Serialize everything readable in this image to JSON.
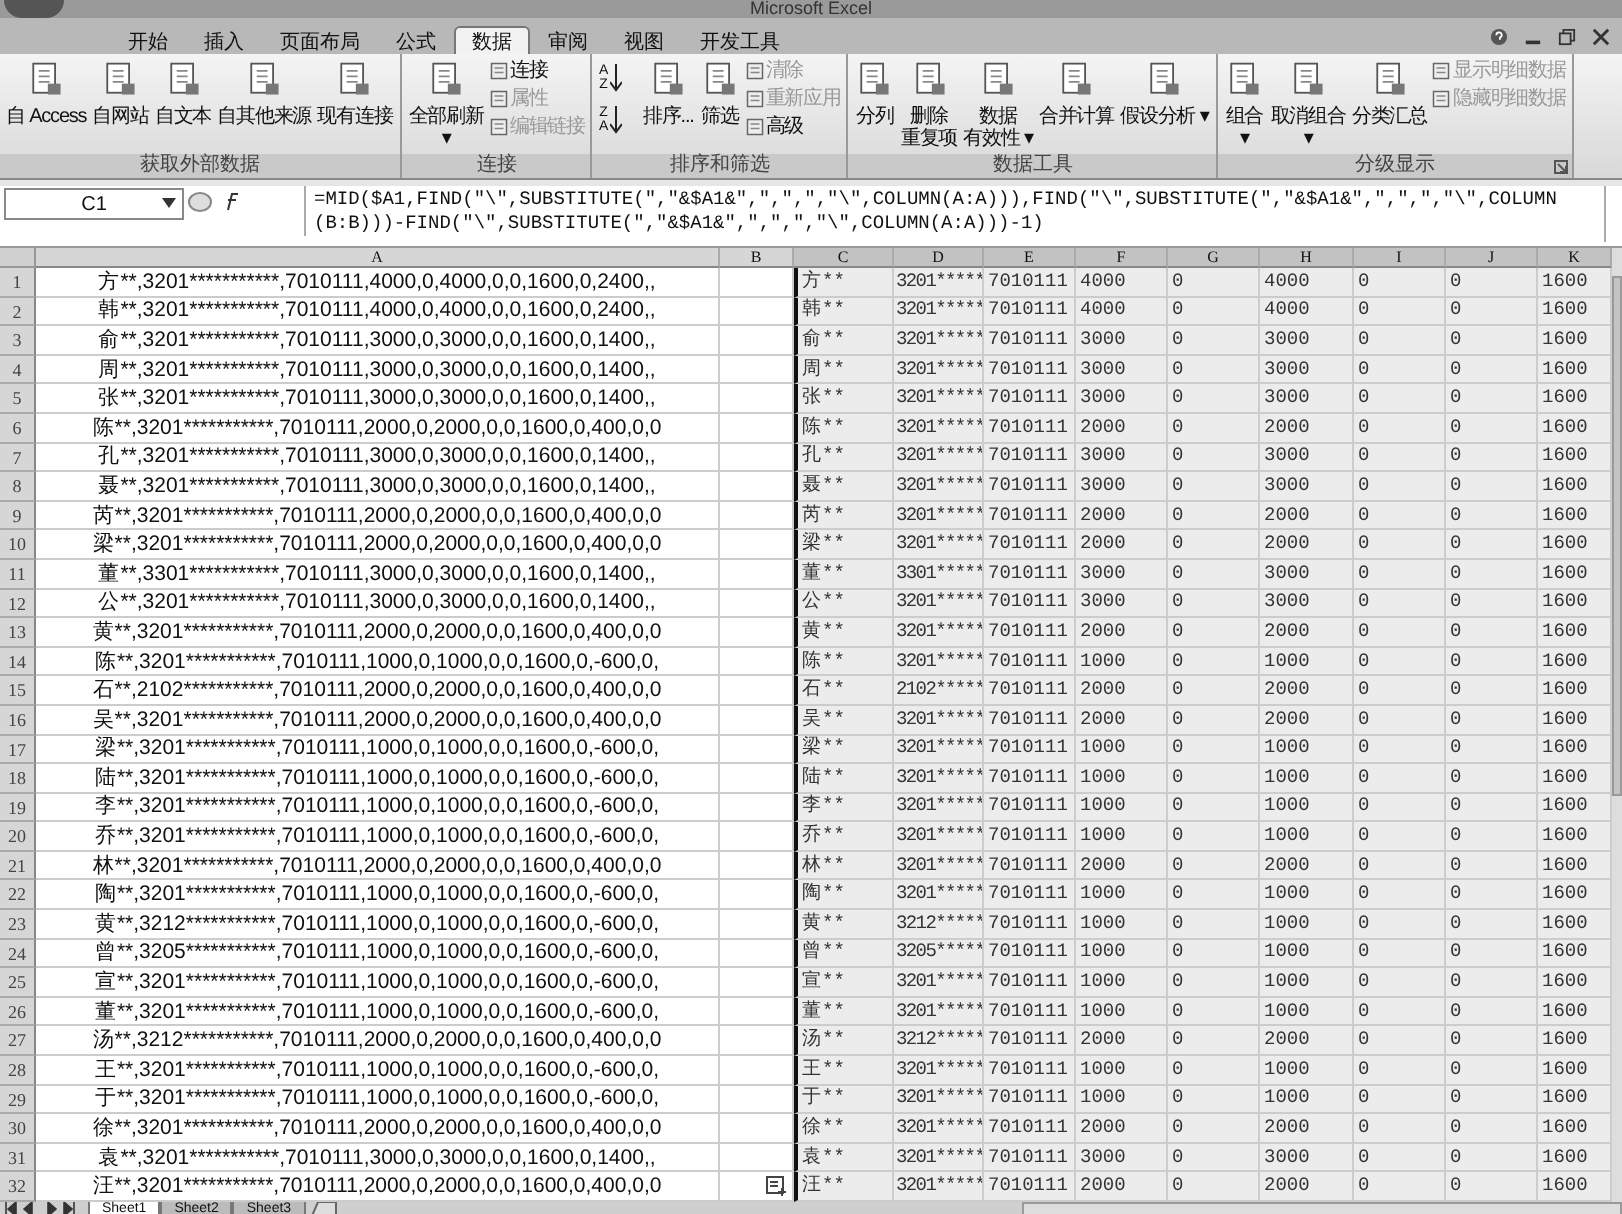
{
  "window": {
    "title": "Microsoft Excel"
  },
  "tabs": [
    {
      "label": "开始",
      "selected": false
    },
    {
      "label": "插入",
      "selected": false
    },
    {
      "label": "页面布局",
      "selected": false
    },
    {
      "label": "公式",
      "selected": false
    },
    {
      "label": "数据",
      "selected": true
    },
    {
      "label": "审阅",
      "selected": false
    },
    {
      "label": "视图",
      "selected": false
    },
    {
      "label": "开发工具",
      "selected": false
    }
  ],
  "ribbon_groups": [
    {
      "label": "获取外部数据",
      "launcher": false,
      "buttons": [
        {
          "kind": "large",
          "lines": [
            "自 Access"
          ]
        },
        {
          "kind": "large",
          "lines": [
            "自网站"
          ]
        },
        {
          "kind": "large",
          "lines": [
            "自文本"
          ]
        },
        {
          "kind": "large",
          "lines": [
            "自其他来源"
          ]
        },
        {
          "kind": "large",
          "lines": [
            "现有连接"
          ]
        }
      ]
    },
    {
      "label": "连接",
      "launcher": false,
      "buttons": [
        {
          "kind": "large",
          "lines": [
            "全部刷新",
            "▾"
          ]
        },
        {
          "kind": "small",
          "label": "连接",
          "disabled": false
        },
        {
          "kind": "small",
          "label": "属性",
          "disabled": true
        },
        {
          "kind": "small",
          "label": "编辑链接",
          "disabled": true
        }
      ]
    },
    {
      "label": "排序和筛选",
      "launcher": false,
      "buttons": [
        {
          "kind": "sort",
          "label": "A Z"
        },
        {
          "kind": "sort",
          "label": "Z A"
        },
        {
          "kind": "large",
          "lines": [
            "排序..."
          ]
        },
        {
          "kind": "large",
          "lines": [
            "筛选"
          ]
        },
        {
          "kind": "small",
          "label": "清除",
          "disabled": true
        },
        {
          "kind": "small",
          "label": "重新应用",
          "disabled": true
        },
        {
          "kind": "small",
          "label": "高级",
          "disabled": false
        }
      ]
    },
    {
      "label": "数据工具",
      "launcher": false,
      "buttons": [
        {
          "kind": "large",
          "lines": [
            "分列"
          ]
        },
        {
          "kind": "large",
          "lines": [
            "删除",
            "重复项"
          ]
        },
        {
          "kind": "large",
          "lines": [
            "数据",
            "有效性 ▾"
          ]
        },
        {
          "kind": "large",
          "lines": [
            "合并计算"
          ]
        },
        {
          "kind": "large",
          "lines": [
            "假设分析 ▾"
          ]
        }
      ]
    },
    {
      "label": "分级显示",
      "launcher": true,
      "buttons": [
        {
          "kind": "large",
          "lines": [
            "组合",
            "▾"
          ]
        },
        {
          "kind": "large",
          "lines": [
            "取消组合",
            "▾"
          ]
        },
        {
          "kind": "large",
          "lines": [
            "分类汇总"
          ]
        },
        {
          "kind": "small",
          "label": "显示明细数据",
          "disabled": true
        },
        {
          "kind": "small",
          "label": "隐藏明细数据",
          "disabled": true
        }
      ]
    }
  ],
  "formula_bar": {
    "name_box": "C1",
    "formula": "=MID($A1,FIND(\"\\\",SUBSTITUTE(\",\"&$A1&\",\",\",\",\"\\\",COLUMN(A:A))),FIND(\"\\\",SUBSTITUTE(\",\"&$A1&\",\",\",\",\"\\\",COLUMN(B:B)))-FIND(\"\\\",SUBSTITUTE(\",\"&$A1&\",\",\",\",\"\\\",COLUMN(A:A)))-1)"
  },
  "sheet": {
    "columns": [
      "A",
      "B",
      "C",
      "D",
      "E",
      "F",
      "G",
      "H",
      "I",
      "J",
      "K"
    ],
    "rows": [
      {
        "number": "1",
        "a": "方**,3201***********,7010111,4000,0,4000,0,0,1600,0,2400,,",
        "values": [
          "方**",
          "3201*****",
          "7010111",
          "4000",
          "0",
          "4000",
          "0",
          "0",
          "1600"
        ]
      },
      {
        "number": "2",
        "a": "韩**,3201***********,7010111,4000,0,4000,0,0,1600,0,2400,,",
        "values": [
          "韩**",
          "3201*****",
          "7010111",
          "4000",
          "0",
          "4000",
          "0",
          "0",
          "1600"
        ]
      },
      {
        "number": "3",
        "a": "俞**,3201***********,7010111,3000,0,3000,0,0,1600,0,1400,,",
        "values": [
          "俞**",
          "3201*****",
          "7010111",
          "3000",
          "0",
          "3000",
          "0",
          "0",
          "1600"
        ]
      },
      {
        "number": "4",
        "a": "周**,3201***********,7010111,3000,0,3000,0,0,1600,0,1400,,",
        "values": [
          "周**",
          "3201*****",
          "7010111",
          "3000",
          "0",
          "3000",
          "0",
          "0",
          "1600"
        ]
      },
      {
        "number": "5",
        "a": "张**,3201***********,7010111,3000,0,3000,0,0,1600,0,1400,,",
        "values": [
          "张**",
          "3201*****",
          "7010111",
          "3000",
          "0",
          "3000",
          "0",
          "0",
          "1600"
        ]
      },
      {
        "number": "6",
        "a": "陈**,3201***********,7010111,2000,0,2000,0,0,1600,0,400,0,0",
        "values": [
          "陈**",
          "3201*****",
          "7010111",
          "2000",
          "0",
          "2000",
          "0",
          "0",
          "1600"
        ]
      },
      {
        "number": "7",
        "a": "孔**,3201***********,7010111,3000,0,3000,0,0,1600,0,1400,,",
        "values": [
          "孔**",
          "3201*****",
          "7010111",
          "3000",
          "0",
          "3000",
          "0",
          "0",
          "1600"
        ]
      },
      {
        "number": "8",
        "a": "聂**,3201***********,7010111,3000,0,3000,0,0,1600,0,1400,,",
        "values": [
          "聂**",
          "3201*****",
          "7010111",
          "3000",
          "0",
          "3000",
          "0",
          "0",
          "1600"
        ]
      },
      {
        "number": "9",
        "a": "芮**,3201***********,7010111,2000,0,2000,0,0,1600,0,400,0,0",
        "values": [
          "芮**",
          "3201*****",
          "7010111",
          "2000",
          "0",
          "2000",
          "0",
          "0",
          "1600"
        ]
      },
      {
        "number": "10",
        "a": "梁**,3201***********,7010111,2000,0,2000,0,0,1600,0,400,0,0",
        "values": [
          "梁**",
          "3201*****",
          "7010111",
          "2000",
          "0",
          "2000",
          "0",
          "0",
          "1600"
        ]
      },
      {
        "number": "11",
        "a": "董**,3301***********,7010111,3000,0,3000,0,0,1600,0,1400,,",
        "values": [
          "董**",
          "3301*****",
          "7010111",
          "3000",
          "0",
          "3000",
          "0",
          "0",
          "1600"
        ]
      },
      {
        "number": "12",
        "a": "公**,3201***********,7010111,3000,0,3000,0,0,1600,0,1400,,",
        "values": [
          "公**",
          "3201*****",
          "7010111",
          "3000",
          "0",
          "3000",
          "0",
          "0",
          "1600"
        ]
      },
      {
        "number": "13",
        "a": "黄**,3201***********,7010111,2000,0,2000,0,0,1600,0,400,0,0",
        "values": [
          "黄**",
          "3201*****",
          "7010111",
          "2000",
          "0",
          "2000",
          "0",
          "0",
          "1600"
        ]
      },
      {
        "number": "14",
        "a": "陈**,3201***********,7010111,1000,0,1000,0,0,1600,0,-600,0,",
        "values": [
          "陈**",
          "3201*****",
          "7010111",
          "1000",
          "0",
          "1000",
          "0",
          "0",
          "1600"
        ]
      },
      {
        "number": "15",
        "a": "石**,2102***********,7010111,2000,0,2000,0,0,1600,0,400,0,0",
        "values": [
          "石**",
          "2102*****",
          "7010111",
          "2000",
          "0",
          "2000",
          "0",
          "0",
          "1600"
        ]
      },
      {
        "number": "16",
        "a": "吴**,3201***********,7010111,2000,0,2000,0,0,1600,0,400,0,0",
        "values": [
          "吴**",
          "3201*****",
          "7010111",
          "2000",
          "0",
          "2000",
          "0",
          "0",
          "1600"
        ]
      },
      {
        "number": "17",
        "a": "梁**,3201***********,7010111,1000,0,1000,0,0,1600,0,-600,0,",
        "values": [
          "梁**",
          "3201*****",
          "7010111",
          "1000",
          "0",
          "1000",
          "0",
          "0",
          "1600"
        ]
      },
      {
        "number": "18",
        "a": "陆**,3201***********,7010111,1000,0,1000,0,0,1600,0,-600,0,",
        "values": [
          "陆**",
          "3201*****",
          "7010111",
          "1000",
          "0",
          "1000",
          "0",
          "0",
          "1600"
        ]
      },
      {
        "number": "19",
        "a": "李**,3201***********,7010111,1000,0,1000,0,0,1600,0,-600,0,",
        "values": [
          "李**",
          "3201*****",
          "7010111",
          "1000",
          "0",
          "1000",
          "0",
          "0",
          "1600"
        ]
      },
      {
        "number": "20",
        "a": "乔**,3201***********,7010111,1000,0,1000,0,0,1600,0,-600,0,",
        "values": [
          "乔**",
          "3201*****",
          "7010111",
          "1000",
          "0",
          "1000",
          "0",
          "0",
          "1600"
        ]
      },
      {
        "number": "21",
        "a": "林**,3201***********,7010111,2000,0,2000,0,0,1600,0,400,0,0",
        "values": [
          "林**",
          "3201*****",
          "7010111",
          "2000",
          "0",
          "2000",
          "0",
          "0",
          "1600"
        ]
      },
      {
        "number": "22",
        "a": "陶**,3201***********,7010111,1000,0,1000,0,0,1600,0,-600,0,",
        "values": [
          "陶**",
          "3201*****",
          "7010111",
          "1000",
          "0",
          "1000",
          "0",
          "0",
          "1600"
        ]
      },
      {
        "number": "23",
        "a": "黄**,3212***********,7010111,1000,0,1000,0,0,1600,0,-600,0,",
        "values": [
          "黄**",
          "3212*****",
          "7010111",
          "1000",
          "0",
          "1000",
          "0",
          "0",
          "1600"
        ]
      },
      {
        "number": "24",
        "a": "曾**,3205***********,7010111,1000,0,1000,0,0,1600,0,-600,0,",
        "values": [
          "曾**",
          "3205*****",
          "7010111",
          "1000",
          "0",
          "1000",
          "0",
          "0",
          "1600"
        ]
      },
      {
        "number": "25",
        "a": "宣**,3201***********,7010111,1000,0,1000,0,0,1600,0,-600,0,",
        "values": [
          "宣**",
          "3201*****",
          "7010111",
          "1000",
          "0",
          "1000",
          "0",
          "0",
          "1600"
        ]
      },
      {
        "number": "26",
        "a": "董**,3201***********,7010111,1000,0,1000,0,0,1600,0,-600,0,",
        "values": [
          "董**",
          "3201*****",
          "7010111",
          "1000",
          "0",
          "1000",
          "0",
          "0",
          "1600"
        ]
      },
      {
        "number": "27",
        "a": "汤**,3212***********,7010111,2000,0,2000,0,0,1600,0,400,0,0",
        "values": [
          "汤**",
          "3212*****",
          "7010111",
          "2000",
          "0",
          "2000",
          "0",
          "0",
          "1600"
        ]
      },
      {
        "number": "28",
        "a": "王**,3201***********,7010111,1000,0,1000,0,0,1600,0,-600,0,",
        "values": [
          "王**",
          "3201*****",
          "7010111",
          "1000",
          "0",
          "1000",
          "0",
          "0",
          "1600"
        ]
      },
      {
        "number": "29",
        "a": "于**,3201***********,7010111,1000,0,1000,0,0,1600,0,-600,0,",
        "values": [
          "于**",
          "3201*****",
          "7010111",
          "1000",
          "0",
          "1000",
          "0",
          "0",
          "1600"
        ]
      },
      {
        "number": "30",
        "a": "徐**,3201***********,7010111,2000,0,2000,0,0,1600,0,400,0,0",
        "values": [
          "徐**",
          "3201*****",
          "7010111",
          "2000",
          "0",
          "2000",
          "0",
          "0",
          "1600"
        ]
      },
      {
        "number": "31",
        "a": "袁**,3201***********,7010111,3000,0,3000,0,0,1600,0,1400,,",
        "values": [
          "袁**",
          "3201*****",
          "7010111",
          "3000",
          "0",
          "3000",
          "0",
          "0",
          "1600"
        ]
      },
      {
        "number": "32",
        "a": "汪**,3201***********,7010111,2000,0,2000,0,0,1600,0,400,0,0",
        "values": [
          "汪**",
          "3201*****",
          "7010111",
          "2000",
          "0",
          "2000",
          "0",
          "0",
          "1600"
        ]
      }
    ]
  },
  "sheet_tabs": [
    {
      "label": "Sheet1",
      "selected": true
    },
    {
      "label": "Sheet2",
      "selected": false
    },
    {
      "label": "Sheet3",
      "selected": false
    }
  ]
}
